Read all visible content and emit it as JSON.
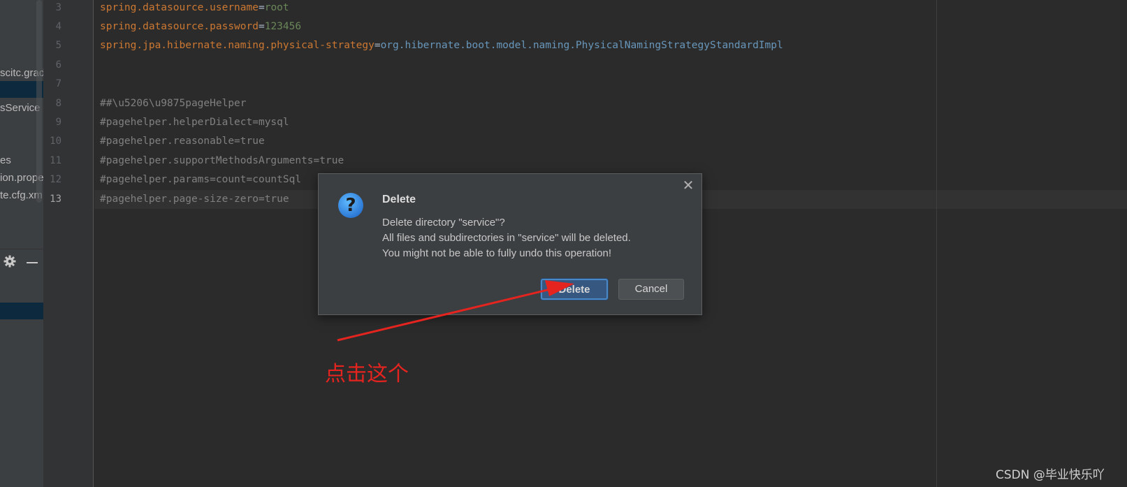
{
  "sidebar": {
    "items": [
      {
        "label": "scitc.grad"
      },
      {
        "label": "sService"
      },
      {
        "label": "es"
      },
      {
        "label": "ion.prope"
      },
      {
        "label": "te.cfg.xm"
      }
    ]
  },
  "gutter": {
    "line_numbers": [
      "3",
      "4",
      "5",
      "6",
      "7",
      "8",
      "9",
      "10",
      "11",
      "12",
      "13"
    ],
    "current_line": "13"
  },
  "editor": {
    "lines": [
      {
        "key": "spring.datasource.username",
        "eq": "=",
        "value": "root"
      },
      {
        "key": "spring.datasource.password",
        "eq": "=",
        "value": "123456"
      },
      {
        "key": "spring.jpa.hibernate.naming.physical-strategy",
        "eq": "=",
        "value": "org.hibernate.boot.model.naming.PhysicalNamingStrategyStandardImpl"
      },
      {
        "comment": "##\\u5206\\u9875pageHelper"
      },
      {
        "comment": "#pagehelper.helperDialect=mysql"
      },
      {
        "comment": "#pagehelper.reasonable=true"
      },
      {
        "comment": "#pagehelper.supportMethodsArguments=true"
      },
      {
        "comment": "#pagehelper.params=count=countSql"
      },
      {
        "comment": "#pagehelper.page-size-zero=true"
      }
    ]
  },
  "dialog": {
    "title": "Delete",
    "line1": "Delete directory \"service\"?",
    "line2": "All files and subdirectories in \"service\" will be deleted.",
    "line3": "You might not be able to fully undo this operation!",
    "delete_label": "Delete",
    "cancel_label": "Cancel",
    "close_glyph": "✕",
    "icon_glyph": "?"
  },
  "annotation": {
    "text": "点击这个",
    "color": "#e5241f"
  },
  "watermark": "CSDN @毕业快乐吖",
  "colors": {
    "editor_bg": "#2b2b2b",
    "keyword": "#cc7832",
    "string_value": "#6a8759",
    "comment": "#808080",
    "primary_button": "#365880"
  }
}
